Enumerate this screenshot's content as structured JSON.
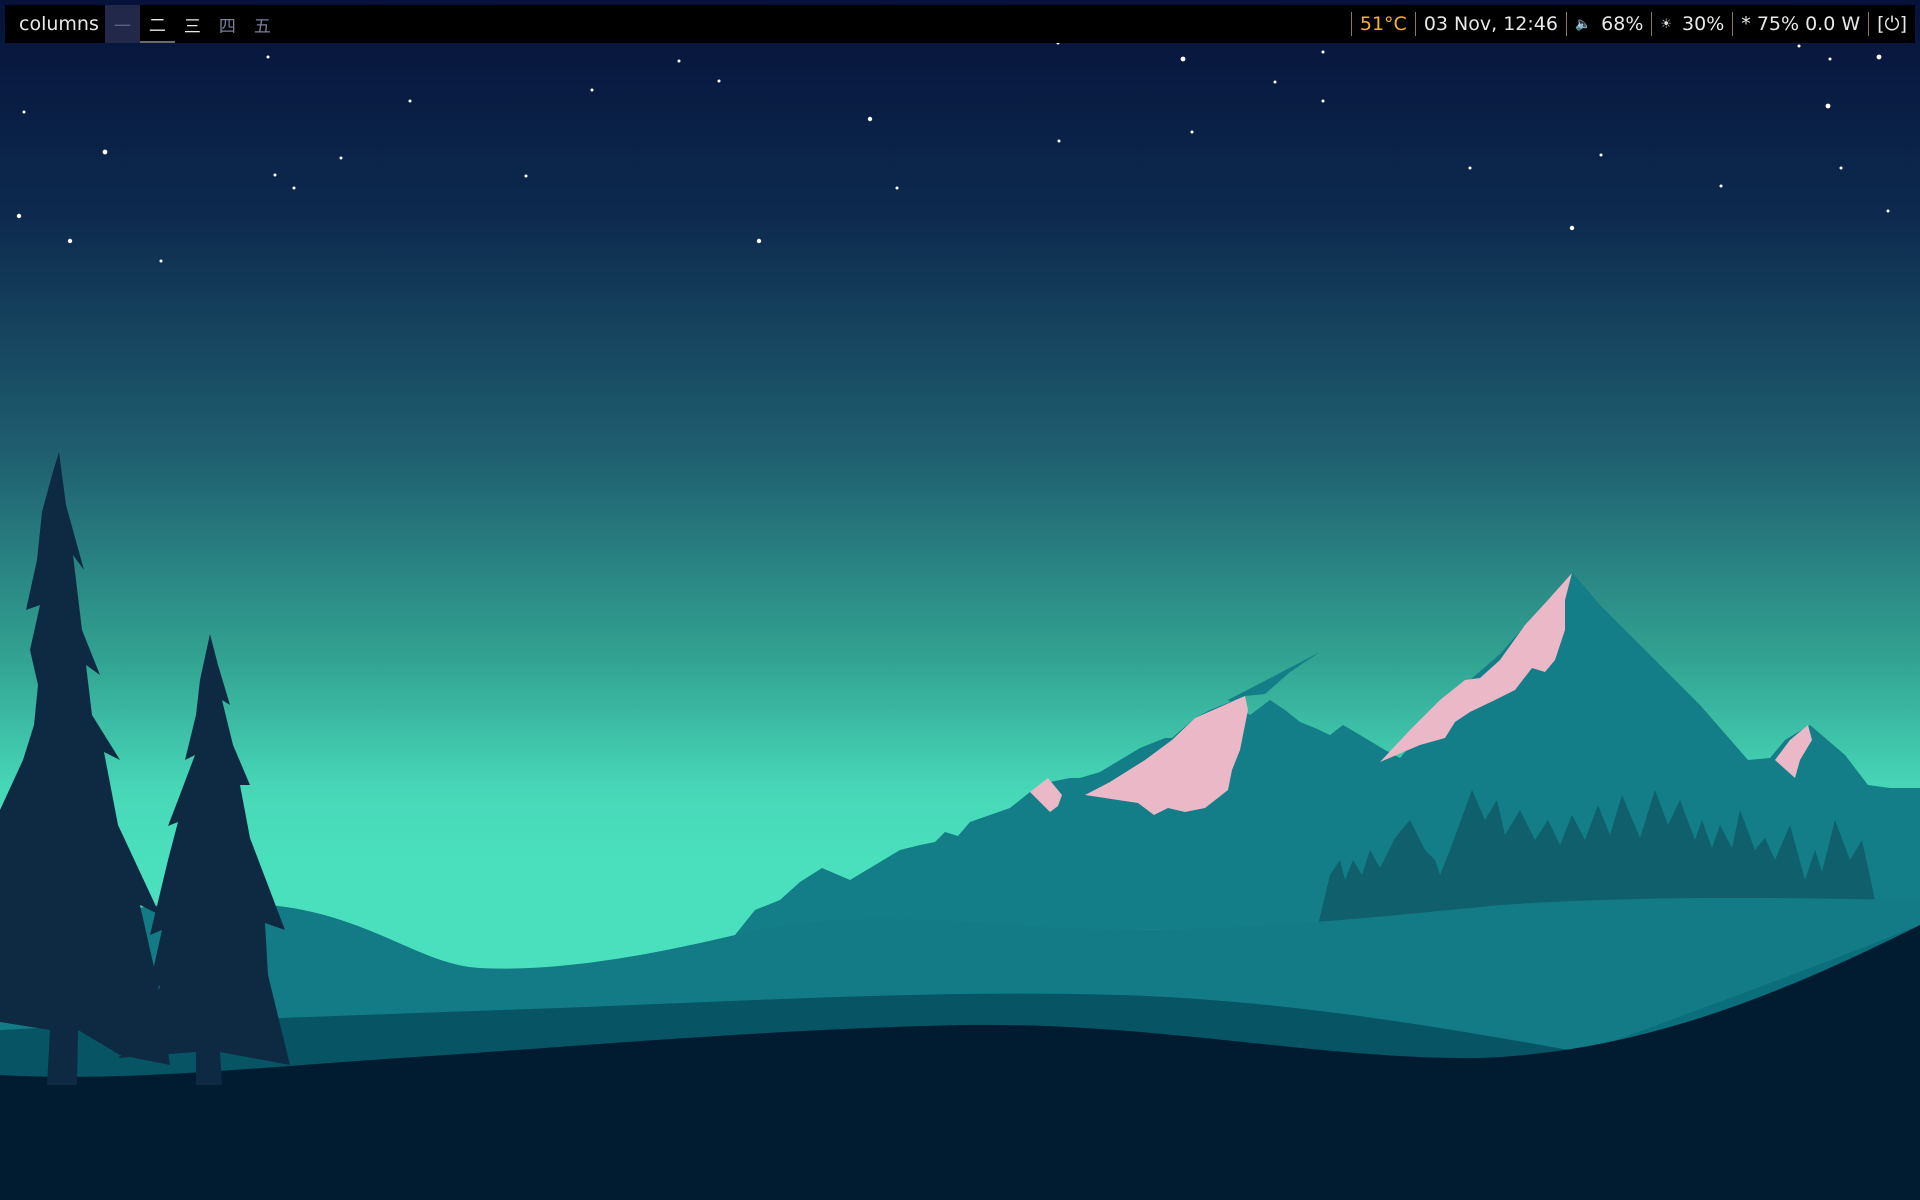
{
  "topbar": {
    "layout": "columns",
    "workspaces": [
      {
        "label": "一",
        "state": "focused"
      },
      {
        "label": "二",
        "state": "occupied"
      },
      {
        "label": "三",
        "state": "normal"
      },
      {
        "label": "四",
        "state": "empty"
      },
      {
        "label": "五",
        "state": "empty"
      }
    ],
    "temperature": "51°C",
    "datetime": "03 Nov, 12:46",
    "volume_icon": "🔈",
    "volume": "68%",
    "brightness_icon": "☀",
    "brightness": "30%",
    "battery": "* 75% 0.0 W",
    "power_label": "[⏻]"
  },
  "colors": {
    "bar_bg": "#000000",
    "bar_text": "#e8e8e8",
    "temperature": "#f2b233",
    "focused_ws_bg": "#22284a",
    "sky_top": "#06123a",
    "sky_mid": "#1f5f70",
    "sky_horizon": "#4be0bd",
    "snow": "#ebb8c8",
    "mountain": "#137e87",
    "trees": "#0e2a42",
    "ground": "#011b31"
  }
}
